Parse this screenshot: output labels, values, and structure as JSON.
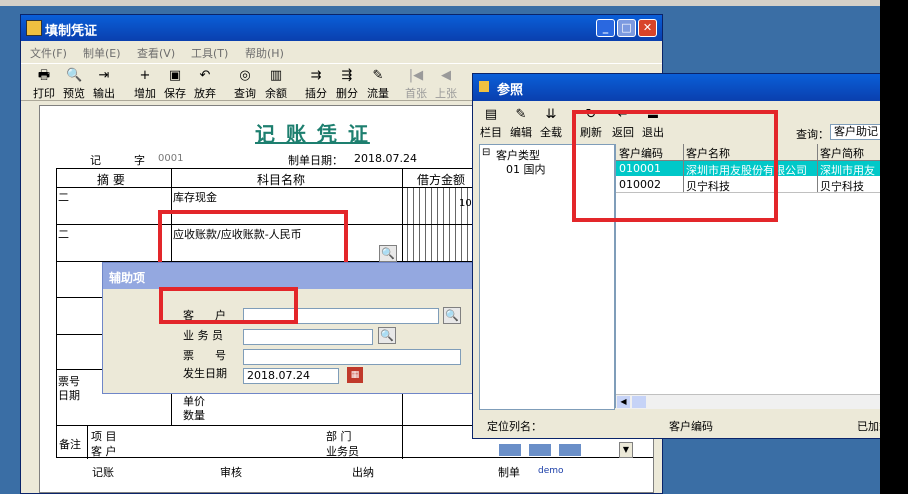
{
  "main_window": {
    "title": "填制凭证",
    "menu": [
      "文件(F)",
      "制单(E)",
      "查看(V)",
      "工具(T)",
      "帮助(H)"
    ],
    "toolbar": [
      {
        "label": "打印",
        "icon": "printer-icon",
        "glyph": "🖶"
      },
      {
        "label": "预览",
        "icon": "preview-icon",
        "glyph": "🔍"
      },
      {
        "label": "输出",
        "icon": "export-icon",
        "glyph": "⇥"
      },
      {
        "label": "增加",
        "icon": "add-icon",
        "glyph": "+"
      },
      {
        "label": "保存",
        "icon": "save-icon",
        "glyph": "▣"
      },
      {
        "label": "放弃",
        "icon": "undo-icon",
        "glyph": "↶"
      },
      {
        "label": "查询",
        "icon": "binoculars-icon",
        "glyph": "◎"
      },
      {
        "label": "余额",
        "icon": "balance-chart-icon",
        "glyph": "▥"
      },
      {
        "label": "插分",
        "icon": "insert-row-icon",
        "glyph": "⇉"
      },
      {
        "label": "删分",
        "icon": "delete-row-icon",
        "glyph": "⇶"
      },
      {
        "label": "流量",
        "icon": "cashflow-icon",
        "glyph": "✎"
      },
      {
        "label": "首张",
        "icon": "first-page-icon",
        "glyph": "|◀"
      },
      {
        "label": "上张",
        "icon": "prev-page-icon",
        "glyph": "◀"
      }
    ]
  },
  "voucher": {
    "title": "记 账 凭 证",
    "type_label": "记",
    "no_label": "字",
    "no_value": "0001",
    "date_label": "制单日期：",
    "date_value": "2018.07.24",
    "col_summary": "摘 要",
    "col_subject": "科目名称",
    "col_debit": "借方金额",
    "rows": [
      {
        "summary": "二",
        "subject": "库存现金",
        "debit": "10"
      },
      {
        "summary": "二",
        "subject": "应收账款/应收账款-人民币",
        "debit": ""
      }
    ],
    "ticket_no_label": "票号",
    "ticket_date_label": "日期",
    "unit_price_label": "单价",
    "quantity_label": "数量",
    "note_label": "备注",
    "project_label": "项  目",
    "customer_label": "客  户",
    "department_label": "部  门",
    "salesman_label": "业务员",
    "footer": [
      "记账",
      "审核",
      "出纳",
      "制单"
    ],
    "maker": "demo"
  },
  "aux_dialog": {
    "title": "辅助项",
    "customer_label": "客      户",
    "salesman_label": "业 务 员",
    "ticket_label": "票      号",
    "date_label": "发生日期",
    "date_value": "2018.07.24"
  },
  "ref_window": {
    "title": "参照",
    "toolbar": [
      {
        "label": "栏目",
        "icon": "columns-icon"
      },
      {
        "label": "编辑",
        "icon": "edit-icon"
      },
      {
        "label": "全载",
        "icon": "load-all-icon"
      },
      {
        "label": "刷新",
        "icon": "refresh-icon"
      },
      {
        "label": "返回",
        "icon": "return-icon"
      },
      {
        "label": "退出",
        "icon": "exit-icon"
      }
    ],
    "query_label": "查询：",
    "query_value": "客户助记",
    "tree_root": "客户类型",
    "tree_child": "01 国内",
    "columns": [
      "客户编码",
      "客户名称",
      "客户简称"
    ],
    "rows": [
      [
        "010001",
        "深圳市用友股份有限公司",
        "深圳市用友"
      ],
      [
        "010002",
        "贝宁科技",
        "贝宁科技"
      ]
    ],
    "status_locate": "定位列名：",
    "status_col": "客户编码",
    "status_right": "已加载"
  },
  "colors": {
    "accent": "#0a246a",
    "highlight": "#00c8c8",
    "red_box": "#e3262a",
    "voucher_title": "#1d7f6f"
  }
}
